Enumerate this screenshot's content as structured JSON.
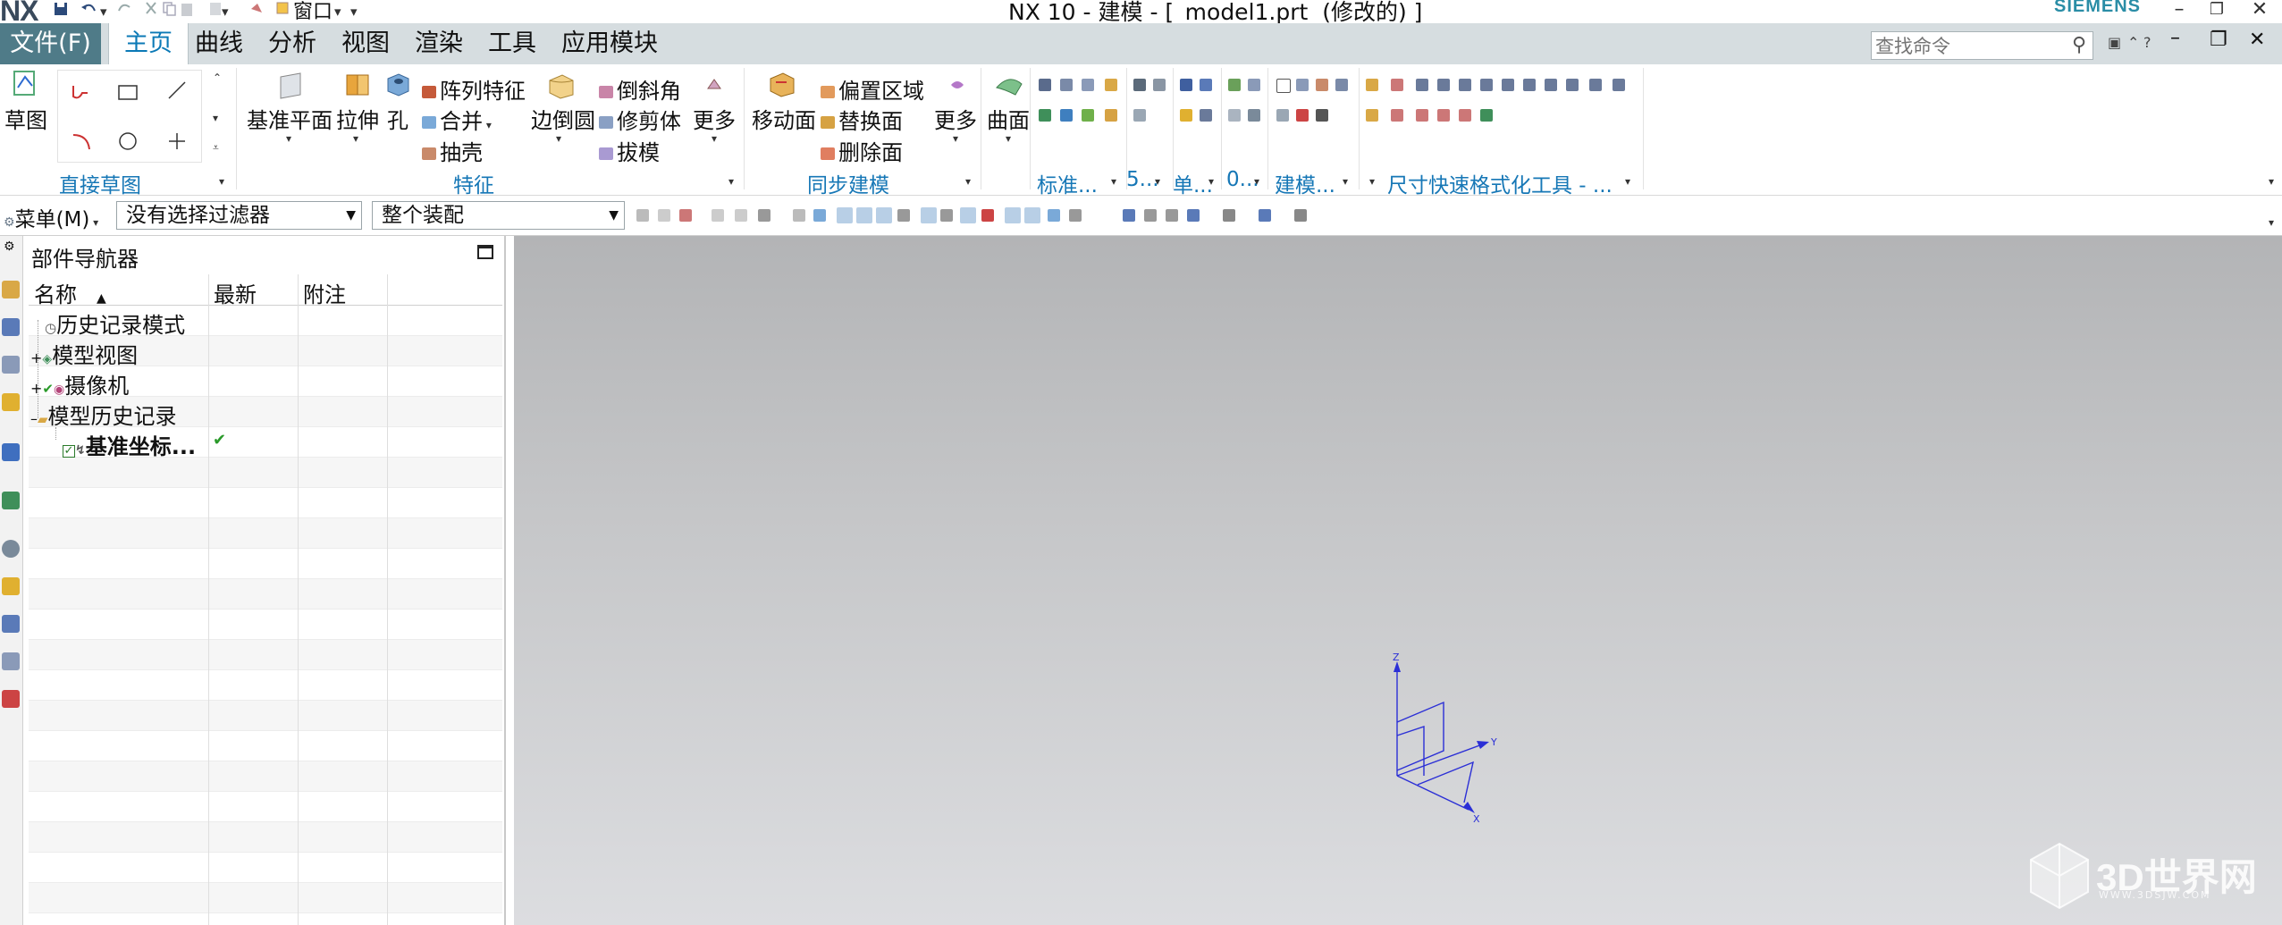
{
  "titlebar": {
    "logo": "NX",
    "window_menu": "窗口",
    "title": "NX 10 - 建模 - [_model1.prt  (修改的) ]",
    "brand": "SIEMENS"
  },
  "menubar": {
    "file": "文件(F)",
    "tabs": [
      "主页",
      "曲线",
      "分析",
      "视图",
      "渲染",
      "工具",
      "应用模块"
    ],
    "search_placeholder": "查找命令"
  },
  "ribbon": {
    "sketch": "草图",
    "groups": {
      "direct_sketch": "直接草图",
      "feature": "特征",
      "sync": "同步建模",
      "standard": "标准...",
      "g5": "5...",
      "single": "单...",
      "g7": "0...",
      "modeling": "建模...",
      "dim_format": "尺寸快速格式化工具 - ..."
    },
    "feature": {
      "datum_plane": "基准平面",
      "extrude": "拉伸",
      "hole": "孔",
      "pattern": "阵列特征",
      "unite": "合并",
      "shell": "抽壳",
      "edge_blend": "边倒圆",
      "chamfer": "倒斜角",
      "trim_body": "修剪体",
      "draft": "拔模",
      "more": "更多"
    },
    "sync": {
      "move_face": "移动面",
      "offset_region": "偏置区域",
      "replace_face": "替换面",
      "delete_face": "删除面",
      "more": "更多"
    },
    "surface": "曲面"
  },
  "filterbar": {
    "menu": "菜单(M)",
    "selection_filter": "没有选择过滤器",
    "scope": "整个装配"
  },
  "navigator": {
    "title": "部件导航器",
    "columns": [
      "名称",
      "最新",
      "附注"
    ],
    "nodes": [
      {
        "label": "历史记录模式"
      },
      {
        "label": "模型视图"
      },
      {
        "label": "摄像机"
      },
      {
        "label": "模型历史记录"
      },
      {
        "label": "基准坐标...",
        "status": "✔"
      }
    ]
  },
  "viewport": {
    "axis_labels": {
      "z": "Z",
      "y": "Y",
      "x": "X"
    },
    "watermark": "3D世界网",
    "watermark_url": "WWW.3DSJW.COM"
  },
  "colors": {
    "file_tab": "#4f7b88",
    "menubar": "#d6dde0",
    "accent_blue": "#1677b6",
    "axis_blue": "#2b2fd6"
  }
}
